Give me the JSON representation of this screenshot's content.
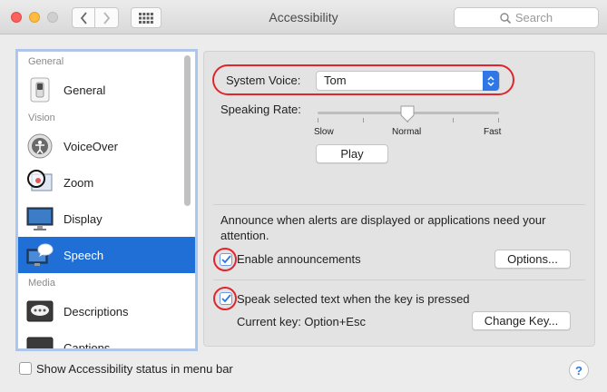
{
  "window": {
    "title": "Accessibility"
  },
  "search": {
    "placeholder": "Search"
  },
  "sidebar": {
    "sections": [
      {
        "label": "General"
      },
      {
        "label": "Vision"
      },
      {
        "label": "Media"
      }
    ],
    "items": [
      {
        "label": "General",
        "icon": "switch-icon"
      },
      {
        "label": "VoiceOver",
        "icon": "voiceover-icon"
      },
      {
        "label": "Zoom",
        "icon": "zoom-icon"
      },
      {
        "label": "Display",
        "icon": "display-icon"
      },
      {
        "label": "Speech",
        "icon": "speech-icon",
        "selected": true
      },
      {
        "label": "Descriptions",
        "icon": "descriptions-icon"
      },
      {
        "label": "Captions",
        "icon": "captions-icon"
      }
    ]
  },
  "speech": {
    "system_voice_label": "System Voice:",
    "system_voice_value": "Tom",
    "speaking_rate_label": "Speaking Rate:",
    "rate_slow": "Slow",
    "rate_normal": "Normal",
    "rate_fast": "Fast",
    "speaking_rate_value": "Normal",
    "play_label": "Play",
    "announce_text": "Announce when alerts are displayed or applications need your attention.",
    "enable_announcements_label": "Enable announcements",
    "enable_announcements_checked": true,
    "options_label": "Options...",
    "speak_selected_label": "Speak selected text when the key is pressed",
    "speak_selected_checked": true,
    "current_key_label": "Current key: Option+Esc",
    "change_key_label": "Change Key..."
  },
  "footer": {
    "show_status_label": "Show Accessibility status in menu bar",
    "show_status_checked": false,
    "help_label": "?"
  },
  "colors": {
    "accent": "#1f6fd6",
    "highlight_ring": "#e0262c"
  }
}
